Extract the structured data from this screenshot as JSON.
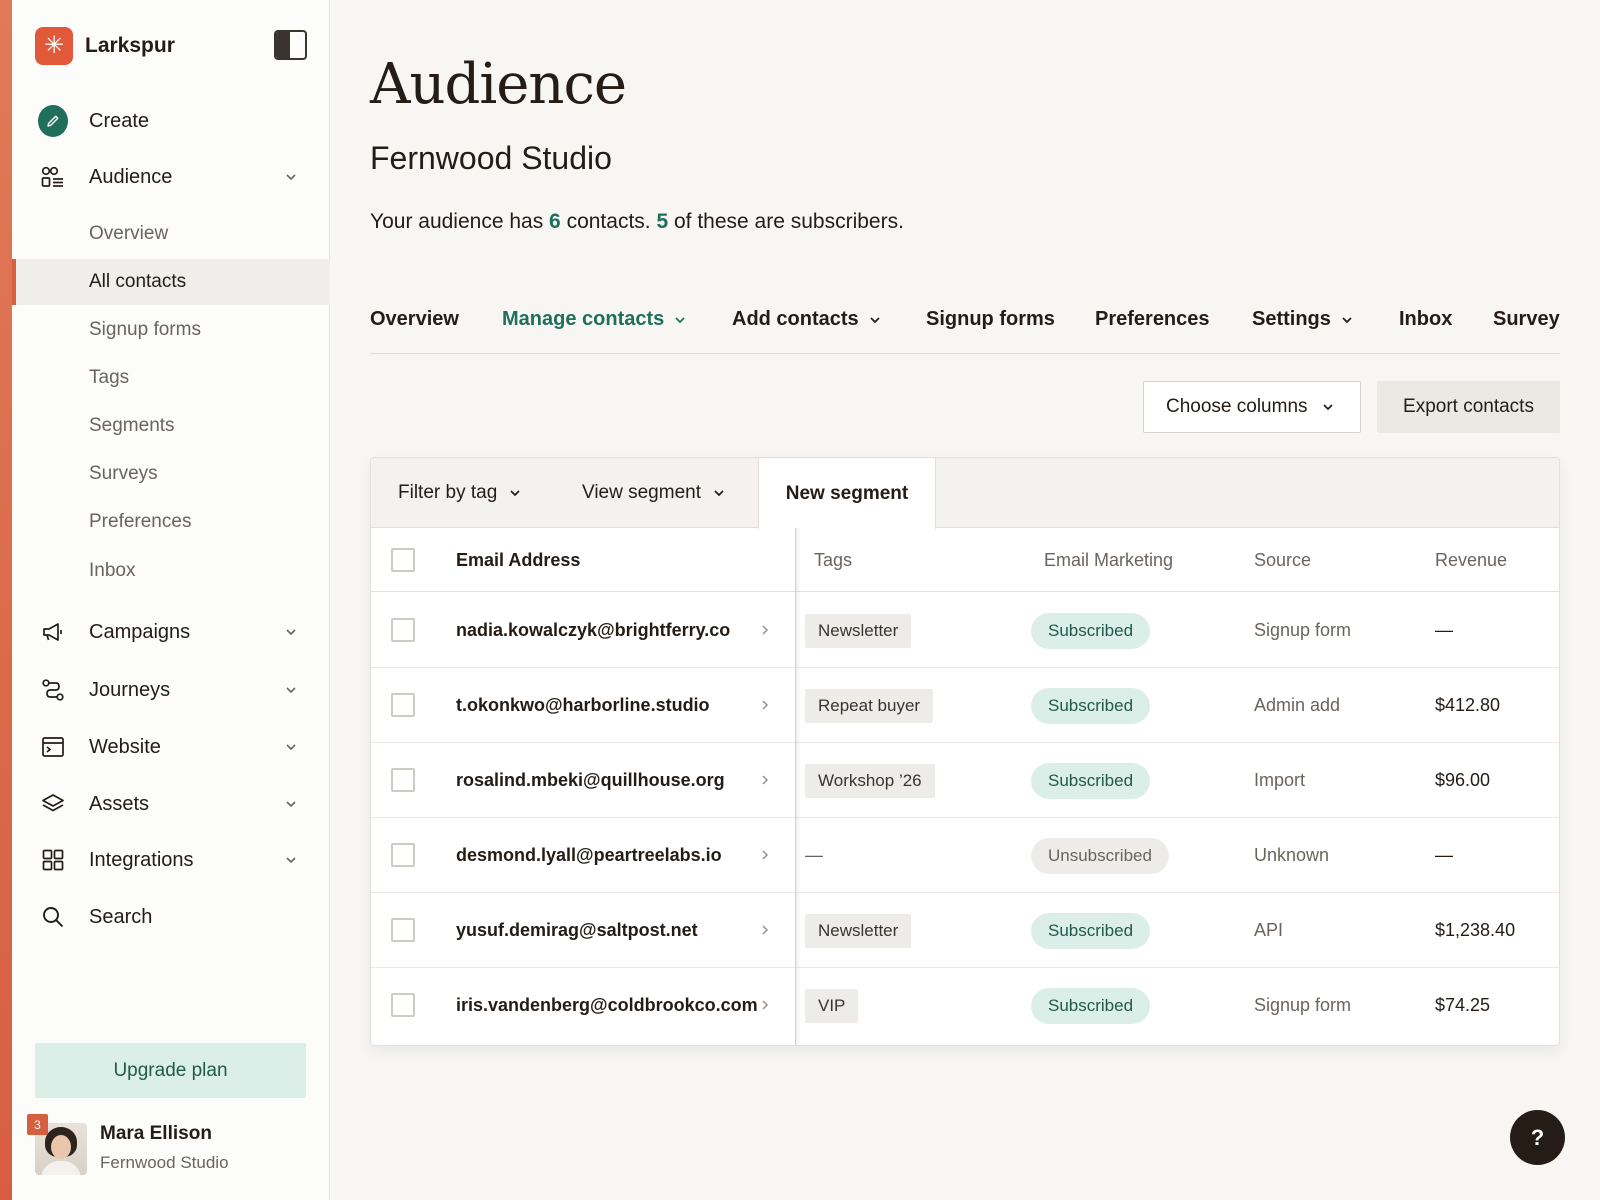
{
  "app": {
    "name": "Larkspur",
    "logo_glyph": "✳",
    "accent_color": "#d65f3f",
    "primary_color": "#1f6f5c"
  },
  "sidebar": {
    "create_label": "Create",
    "audience_label": "Audience",
    "audience_subitems": [
      {
        "label": "Overview",
        "active": false
      },
      {
        "label": "All contacts",
        "active": true
      },
      {
        "label": "Signup forms",
        "active": false
      },
      {
        "label": "Tags",
        "active": false
      },
      {
        "label": "Segments",
        "active": false
      },
      {
        "label": "Surveys",
        "active": false
      },
      {
        "label": "Preferences",
        "active": false
      },
      {
        "label": "Inbox",
        "active": false
      }
    ],
    "sections": [
      {
        "label": "Campaigns",
        "icon": "megaphone-icon"
      },
      {
        "label": "Journeys",
        "icon": "journey-icon"
      },
      {
        "label": "Website",
        "icon": "website-icon"
      },
      {
        "label": "Assets",
        "icon": "layers-icon"
      },
      {
        "label": "Integrations",
        "icon": "grid-icon"
      }
    ],
    "search_label": "Search",
    "upgrade_label": "Upgrade plan",
    "user": {
      "name": "Mara Ellison",
      "org": "Fernwood Studio",
      "notification_count": "3"
    }
  },
  "main": {
    "title": "Audience",
    "org_name": "Fernwood Studio",
    "summary": {
      "prefix": "Your audience has ",
      "contacts": "6",
      "middle": " contacts. ",
      "subscribers": "5",
      "suffix": " of these are subscribers."
    },
    "tabs": [
      {
        "label": "Overview",
        "dropdown": false,
        "active": false
      },
      {
        "label": "Manage contacts",
        "dropdown": true,
        "active": true
      },
      {
        "label": "Add contacts",
        "dropdown": true,
        "active": false
      },
      {
        "label": "Signup forms",
        "dropdown": false,
        "active": false
      },
      {
        "label": "Preferences",
        "dropdown": false,
        "active": false
      },
      {
        "label": "Settings",
        "dropdown": true,
        "active": false
      },
      {
        "label": "Inbox",
        "dropdown": false,
        "active": false
      },
      {
        "label": "Survey",
        "dropdown": false,
        "active": false
      }
    ],
    "choose_columns_label": "Choose columns",
    "export_label": "Export contacts",
    "filter_by_tag_label": "Filter by tag",
    "view_segment_label": "View segment",
    "new_segment_label": "New segment",
    "columns": {
      "email": "Email Address",
      "tags": "Tags",
      "marketing": "Email Marketing",
      "source": "Source",
      "revenue": "Revenue"
    },
    "rows": [
      {
        "email": "nadia.kowalczyk@brightferry.co",
        "tag": "Newsletter",
        "status": "Subscribed",
        "source": "Signup form",
        "revenue": "—"
      },
      {
        "email": "t.okonkwo@harborline.studio",
        "tag": "Repeat buyer",
        "status": "Subscribed",
        "source": "Admin add",
        "revenue": "$412.80"
      },
      {
        "email": "rosalind.mbeki@quillhouse.org",
        "tag": "Workshop ’26",
        "status": "Subscribed",
        "source": "Import",
        "revenue": "$96.00"
      },
      {
        "email": "desmond.lyall@peartreelabs.io",
        "tag": "—",
        "status": "Unsubscribed",
        "source": "Unknown",
        "revenue": "—"
      },
      {
        "email": "yusuf.demirag@saltpost.net",
        "tag": "Newsletter",
        "status": "Subscribed",
        "source": "API",
        "revenue": "$1,238.40"
      },
      {
        "email": "iris.vandenberg@coldbrookco.com",
        "tag": "VIP",
        "status": "Subscribed",
        "source": "Signup form",
        "revenue": "$74.25"
      }
    ],
    "help_label": "?"
  }
}
